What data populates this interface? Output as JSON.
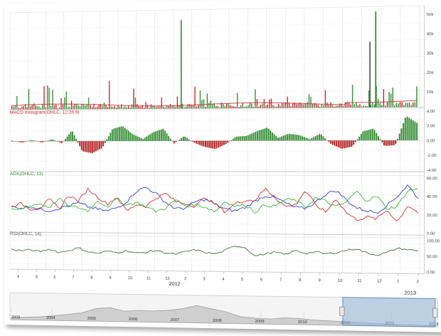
{
  "chart_data": [
    {
      "type": "bar",
      "panel": "volume",
      "label": "",
      "yticks": [
        "10k",
        "20k",
        "30k",
        "40k",
        "50k"
      ],
      "ylim": [
        0,
        52000
      ],
      "colors": {
        "up": "#2e8b2e",
        "down": "#c8202a",
        "ma": "#c8202a"
      },
      "notable_spikes": [
        {
          "month_index": 9.4,
          "value": 48000
        },
        {
          "month_index": 19.7,
          "value": 51000
        },
        {
          "month_index": 19.4,
          "value": 35000
        }
      ]
    },
    {
      "type": "bar",
      "panel": "macd",
      "label": "MACD histogram(OHLC, 12,26,9)",
      "yticks": [
        "4.00",
        "2.00",
        "0.00",
        "-2.00",
        "-4.00"
      ],
      "ylim": [
        -4,
        4
      ],
      "colors": {
        "positive": "#2e8b2e",
        "negative": "#b11c1c"
      },
      "series": [
        {
          "name": "MACD histogram",
          "values": [
            0.1,
            -0.2,
            0.2,
            -0.2,
            0.3,
            -0.3,
            1.6,
            -1.5,
            -1.8,
            -1.0,
            1.8,
            2.2,
            1.0,
            0.3,
            1.3,
            1.8,
            -0.4,
            0.7,
            -0.3,
            -0.9,
            -1.2,
            -0.5,
            0.6,
            0.7,
            1.4,
            1.9,
            0.4,
            1.0,
            0.8,
            0.2,
            1.0,
            -0.5,
            -1.2,
            -0.9,
            1.3,
            1.7,
            -0.8,
            -0.7,
            3.5,
            2.5
          ]
        }
      ]
    },
    {
      "type": "line",
      "panel": "adx",
      "label": "ADX(OHLC, 13)",
      "yticks": [
        "60.00",
        "40.00",
        "20.00",
        "0.00"
      ],
      "ylim": [
        0,
        60
      ],
      "series": [
        {
          "color": "#1a2dcc",
          "values": [
            26,
            25,
            27,
            24,
            22,
            25,
            28,
            31,
            27,
            24,
            22,
            26,
            33,
            45,
            49,
            42,
            32,
            25,
            26,
            33,
            36,
            30,
            25,
            23,
            27,
            34,
            40,
            38,
            32,
            27,
            26,
            33,
            42,
            46,
            36,
            27,
            24,
            22,
            30,
            40,
            52,
            38
          ]
        },
        {
          "color": "#d21e1e",
          "values": [
            27,
            30,
            24,
            25,
            35,
            24,
            40,
            33,
            47,
            38,
            30,
            38,
            22,
            30,
            28,
            37,
            42,
            33,
            31,
            28,
            38,
            30,
            22,
            31,
            35,
            35,
            48,
            38,
            28,
            30,
            46,
            30,
            22,
            37,
            22,
            14,
            17,
            15,
            25,
            12,
            30,
            22
          ]
        },
        {
          "color": "#29b02a",
          "values": [
            22,
            24,
            28,
            30,
            26,
            36,
            27,
            26,
            22,
            34,
            27,
            36,
            29,
            32,
            27,
            22,
            26,
            35,
            28,
            30,
            27,
            22,
            34,
            28,
            30,
            22,
            30,
            28,
            36,
            35,
            27,
            38,
            34,
            28,
            33,
            45,
            35,
            40,
            26,
            29,
            46,
            48
          ]
        }
      ]
    },
    {
      "type": "line",
      "panel": "rsi",
      "label": "RSI(OHLC, 14)",
      "yticks": [
        "100.00",
        "50.00",
        "0.00"
      ],
      "ylim": [
        0,
        100
      ],
      "series": [
        {
          "color": "#3a5f2a",
          "values": [
            60,
            55,
            58,
            52,
            62,
            50,
            57,
            66,
            54,
            48,
            56,
            52,
            58,
            50,
            54,
            60,
            52,
            48,
            57,
            63,
            55,
            50,
            62,
            78,
            72,
            45,
            52,
            58,
            50,
            64,
            55,
            60,
            54,
            58,
            66,
            72,
            58,
            52,
            60,
            74,
            70,
            66
          ]
        }
      ]
    }
  ],
  "xaxis": {
    "ticks": [
      "4",
      "5",
      "6",
      "7",
      "8",
      "9",
      "10",
      "11",
      "12",
      "2",
      "3",
      "4",
      "5",
      "6",
      "7",
      "8",
      "9",
      "10",
      "11",
      "12",
      "1",
      "2"
    ],
    "year_labels": [
      "2012",
      "2013"
    ]
  },
  "navigator": {
    "years": [
      "2003",
      "2004",
      "2005",
      "2006",
      "2007",
      "2008",
      "2009",
      "2010",
      "2011",
      "2012",
      "2013"
    ],
    "range_start_year": "2011",
    "range_end_year": "2013",
    "area_values": [
      0.1,
      0.12,
      0.15,
      0.2,
      0.28,
      0.35,
      0.55,
      0.6,
      0.45,
      0.5,
      0.48,
      0.52,
      0.6,
      0.75,
      0.62,
      0.5,
      0.3,
      0.25,
      0.22,
      0.28,
      0.26,
      0.2,
      0.18,
      0.15,
      0.12,
      0.1,
      0.08,
      0.06,
      0.05,
      0.04
    ]
  }
}
